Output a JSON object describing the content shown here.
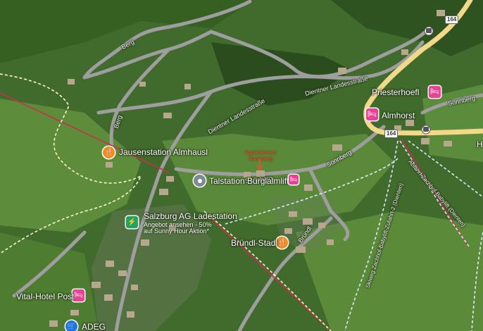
{
  "map": {
    "pois": [
      {
        "name": "Jausenstation Almhausl",
        "category": "restaurant",
        "icon": "fork-knife-icon",
        "color": "#f28b24"
      },
      {
        "name": "Talstation Bürglalmlift",
        "category": "place",
        "icon": "pin-icon",
        "color": "#7d8a92"
      },
      {
        "name": "Salzburg AG Ladestation",
        "category": "ev-charging",
        "icon": "lightning-icon",
        "color": "#1fa462",
        "promo": [
          "Angebot ansehen - 50%",
          "auf Sunny Hour Aktion*"
        ]
      },
      {
        "name": "Bründl-Stadl",
        "category": "restaurant",
        "icon": "fork-knife-icon",
        "color": "#f28b24"
      },
      {
        "name": "Vital-Hotel Post",
        "category": "hotel",
        "icon": "bed-icon",
        "color": "#e84393"
      },
      {
        "name": "ADEG",
        "category": "shop",
        "icon": "cart-icon",
        "color": "#1a73e8"
      },
      {
        "name": "Priesterhoefl",
        "category": "hotel",
        "icon": "bed-icon",
        "color": "#e84393"
      },
      {
        "name": "Almhorst",
        "category": "hotel",
        "icon": "bed-icon",
        "color": "#e84393"
      }
    ],
    "lodging_marker": {
      "name": "Sonnberg",
      "icon": "bed-icon",
      "color": "#e84393"
    },
    "highlight_label": [
      "Appartement",
      "Sonnberg"
    ],
    "highlight_color": "#ff4a2a",
    "roads": [
      "Berg",
      "Berg",
      "Dientner Landesstraße",
      "Dientner Landesstraße",
      "Sonnberg",
      "Sonnberg",
      "Sonnberg",
      "Bründl"
    ],
    "route_shields": [
      "164",
      "164"
    ],
    "lifts": [
      "Abfahrt Zachhof-Babylift (Dienten)",
      "Skiweg Zachhof-Babylift-Zufahrt-2 (Dienten)"
    ],
    "edge_letter": "H",
    "colors": {
      "terrain": "#3f6a2c",
      "meadow": "#5e8f3d",
      "forest": "#24401a",
      "road": "#9e9e9e",
      "highway": "#f2d98a",
      "lift_red": "#c9304a",
      "ski_route": "#dfe9ff"
    }
  }
}
